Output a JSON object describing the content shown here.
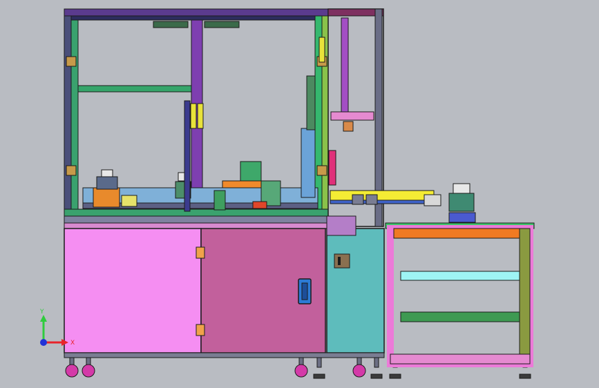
{
  "viewport": {
    "background": "#b9bcc2"
  },
  "triad": {
    "x_label": "X",
    "y_label": "Y",
    "x_color": "#e8232a",
    "y_color": "#2fcc3d",
    "origin_color": "#2133d8"
  },
  "colors": {
    "cabinet_left_door": "#f58ef2",
    "cabinet_right_door": "#c2609c",
    "cabinet_teal": "#5ebcbc",
    "cart_frame": "#ec7ad8",
    "cart_top": "#3ec46a",
    "cart_orange": "#f07a22",
    "cart_cyan": "#9ef4f4",
    "cart_green": "#3e9a52",
    "conveyor_yellow": "#f4ec34",
    "frame_green": "#2fb86a",
    "frame_purple": "#8c4fd0",
    "handle_blue": "#2c7bd6",
    "hinge_orange": "#f0a24a",
    "wheel_magenta": "#d43aa8"
  }
}
